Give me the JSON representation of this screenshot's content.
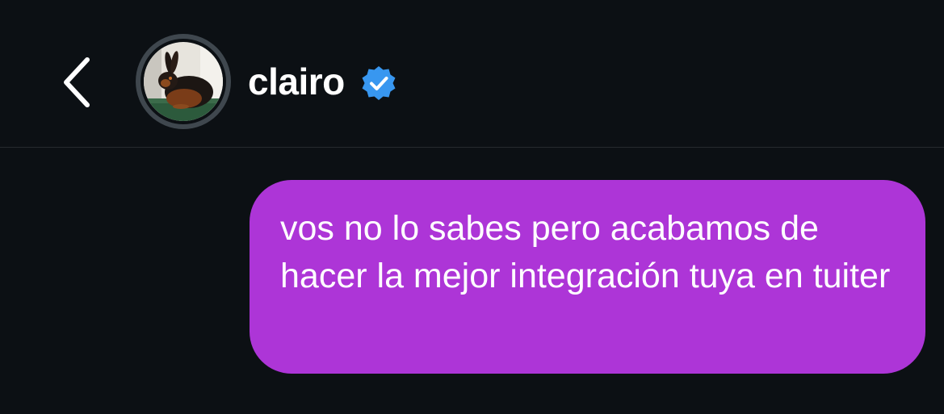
{
  "header": {
    "back_icon": "chevron-left-icon",
    "username": "clairo",
    "verified_icon": "verified-badge-icon",
    "avatar_icon": "rabbit-photo-avatar",
    "verified_color": "#3897f0"
  },
  "conversation": {
    "messages": [
      {
        "direction": "outgoing",
        "text": "vos no lo sabes pero acabamos de hacer la mejor integración tuya en tuiter",
        "bubble_color": "#ad35d7"
      }
    ]
  },
  "theme": {
    "background": "#0c1014",
    "divider": "#262a2f",
    "text": "#ffffff"
  }
}
